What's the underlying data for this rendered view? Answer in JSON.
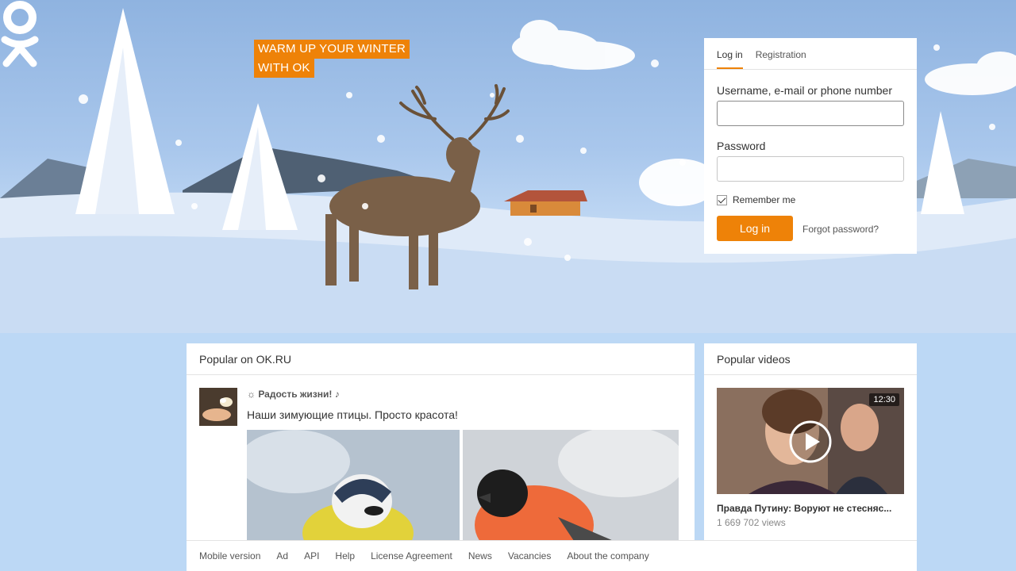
{
  "hero": {
    "slogan_line1": "WARM UP YOUR WINTER",
    "slogan_line2": "WITH OK",
    "logo_icon": "ok-logo-icon",
    "accent": "#ee8208"
  },
  "login": {
    "tabs": [
      {
        "label": "Log in",
        "active": true
      },
      {
        "label": "Registration",
        "active": false
      }
    ],
    "username_label": "Username, e-mail or phone number",
    "username_value": "",
    "password_label": "Password",
    "password_value": "",
    "remember_label": "Remember me",
    "remember_checked": true,
    "login_button": "Log in",
    "forgot_link": "Forgot password?"
  },
  "popular": {
    "title": "Popular on OK.RU",
    "post": {
      "author": "☼ Радость жизни! ♪",
      "text": "Наши зимующие птицы. Просто красота!"
    }
  },
  "videos": {
    "title": "Popular videos",
    "item": {
      "duration": "12:30",
      "title": "Правда Путину: Воруют не стесняс...",
      "views": "1 669 702 views"
    }
  },
  "footer": {
    "links": [
      "Mobile version",
      "Ad",
      "API",
      "Help",
      "License Agreement",
      "News",
      "Vacancies",
      "About the company"
    ]
  }
}
